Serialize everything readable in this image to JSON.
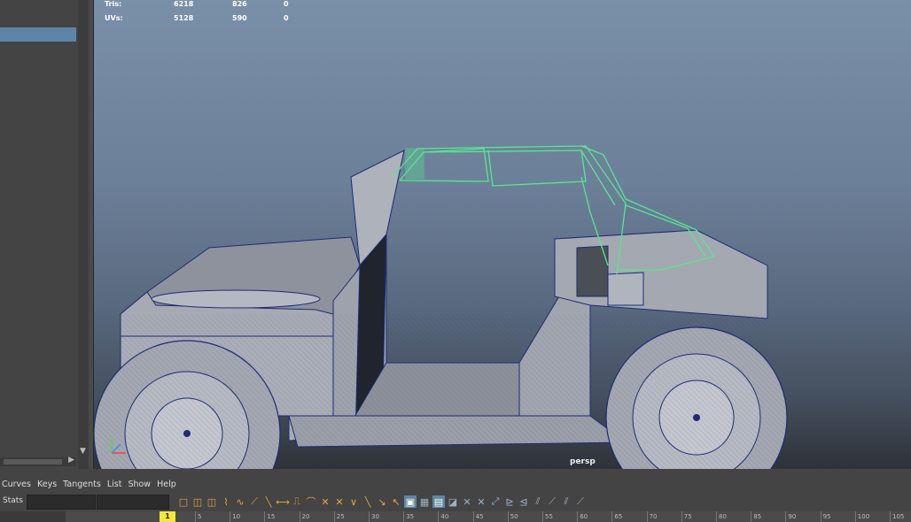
{
  "hud": {
    "rows": [
      {
        "label": "Tris:",
        "v1": "6218",
        "v2": "826",
        "v3": "0"
      },
      {
        "label": "UVs:",
        "v1": "5128",
        "v2": "590",
        "v3": "0"
      }
    ]
  },
  "viewport": {
    "camera": "persp"
  },
  "graph_editor": {
    "menu": [
      "Curves",
      "Keys",
      "Tangents",
      "List",
      "Show",
      "Help"
    ],
    "stats_label": "Stats"
  },
  "timeline": {
    "current_frame": "1",
    "ticks": [
      "5",
      "10",
      "15",
      "20",
      "25",
      "30",
      "35",
      "40",
      "45",
      "50",
      "55",
      "60",
      "65",
      "70",
      "75",
      "80",
      "85",
      "90",
      "95",
      "100",
      "105"
    ]
  },
  "colors": {
    "selection": "#5d85a8",
    "wire_selected": "#55e890",
    "wire": "#1d2b78",
    "mesh": "#9fa3ad",
    "current_frame": "#f5e63b"
  }
}
